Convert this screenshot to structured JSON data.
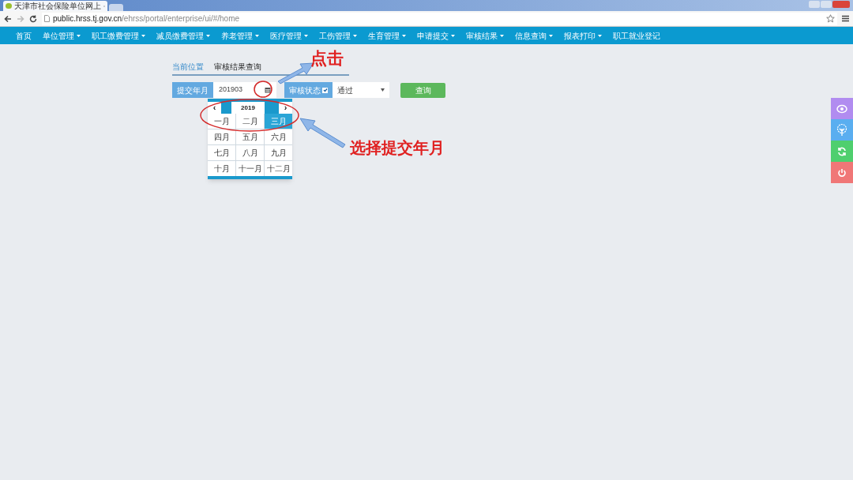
{
  "browser": {
    "tab_title": "天津市社会保险单位网上",
    "url_host": "public.hrss.tj.gov.cn",
    "url_path": "/ehrss/portal/enterprise/ui/#/home"
  },
  "nav": [
    {
      "label": "首页",
      "dropdown": false
    },
    {
      "label": "单位管理",
      "dropdown": true
    },
    {
      "label": "职工缴费管理",
      "dropdown": true
    },
    {
      "label": "减员缴费管理",
      "dropdown": true
    },
    {
      "label": "养老管理",
      "dropdown": true
    },
    {
      "label": "医疗管理",
      "dropdown": true
    },
    {
      "label": "工伤管理",
      "dropdown": true
    },
    {
      "label": "生育管理",
      "dropdown": true
    },
    {
      "label": "申请提交",
      "dropdown": true
    },
    {
      "label": "审核结果",
      "dropdown": true
    },
    {
      "label": "信息查询",
      "dropdown": true
    },
    {
      "label": "报表打印",
      "dropdown": true
    },
    {
      "label": "职工就业登记",
      "dropdown": false
    }
  ],
  "breadcrumb": {
    "label": "当前位置",
    "current": "审核结果查询"
  },
  "form": {
    "month_label": "提交年月",
    "month_value": "201903",
    "status_label": "审核状态",
    "status_checked": true,
    "status_value": "通过",
    "query_button": "查询"
  },
  "calendar": {
    "prev": "‹",
    "year": "2019",
    "next": "›",
    "months": [
      {
        "label": "一月",
        "selected": false
      },
      {
        "label": "二月",
        "selected": false
      },
      {
        "label": "三月",
        "selected": true
      },
      {
        "label": "四月",
        "selected": false
      },
      {
        "label": "五月",
        "selected": false
      },
      {
        "label": "六月",
        "selected": false
      },
      {
        "label": "七月",
        "selected": false
      },
      {
        "label": "八月",
        "selected": false
      },
      {
        "label": "九月",
        "selected": false
      },
      {
        "label": "十月",
        "selected": false
      },
      {
        "label": "十一月",
        "selected": false
      },
      {
        "label": "十二月",
        "selected": false
      }
    ]
  },
  "annotations": {
    "click": "点击",
    "choose": "选择提交年月"
  },
  "side_buttons": [
    {
      "kind": "eye",
      "color": "#b18cf0"
    },
    {
      "kind": "tree",
      "color": "#5aaef0"
    },
    {
      "kind": "refresh",
      "color": "#4fcf6e"
    },
    {
      "kind": "power",
      "color": "#f07777"
    }
  ]
}
